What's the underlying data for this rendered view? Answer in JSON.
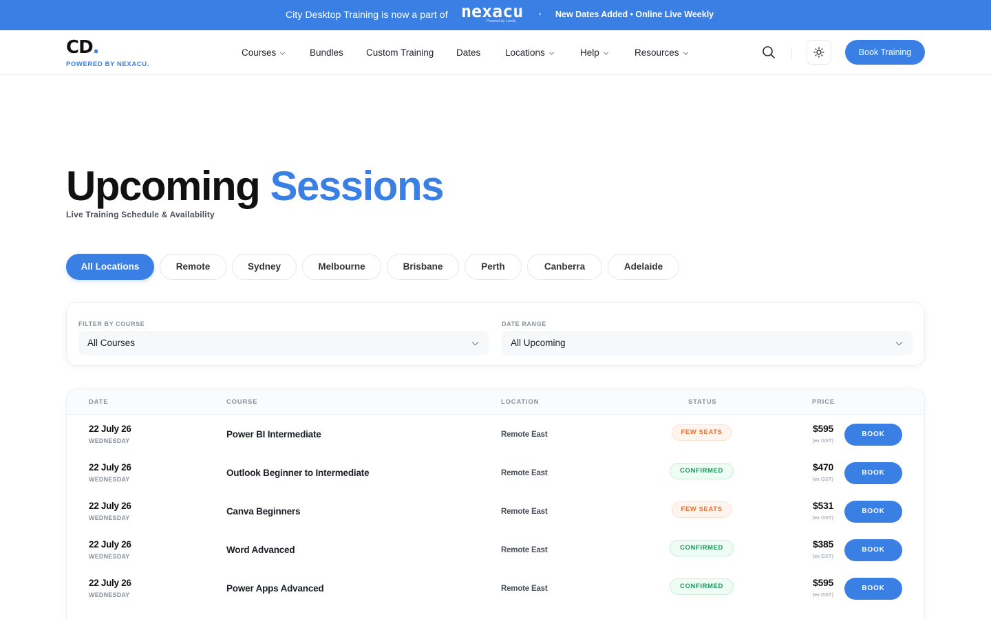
{
  "banner": {
    "text": "City Desktop Training is now a part of",
    "partner_logo": "nexacu",
    "partner_tagline": "Powered by Lumify",
    "news": "New Dates Added • Online Live Weekly"
  },
  "header": {
    "logo_text": "CD",
    "logo_dot": ".",
    "powered_by": "POWERED BY NEXACU.",
    "nav": [
      {
        "label": "Courses",
        "dropdown": true
      },
      {
        "label": "Bundles",
        "dropdown": false
      },
      {
        "label": "Custom Training",
        "dropdown": false
      },
      {
        "label": "Dates",
        "dropdown": false
      },
      {
        "label": "Locations",
        "dropdown": true
      },
      {
        "label": "Help",
        "dropdown": true
      },
      {
        "label": "Resources",
        "dropdown": true
      }
    ],
    "search_icon": "search-icon",
    "theme_icon": "sun-icon",
    "cta_label": "Book Training"
  },
  "hero": {
    "title_main": "Upcoming",
    "title_accent": "Sessions",
    "subtitle": "Live Training Schedule & Availability"
  },
  "locations": {
    "active": "All Locations",
    "items": [
      "All Locations",
      "Remote",
      "Sydney",
      "Melbourne",
      "Brisbane",
      "Perth",
      "Canberra",
      "Adelaide"
    ]
  },
  "filters": {
    "course_label": "FILTER BY COURSE",
    "course_value": "All Courses",
    "date_label": "DATE RANGE",
    "date_value": "All Upcoming"
  },
  "table": {
    "headers": {
      "date": "DATE",
      "course": "COURSE",
      "location": "LOCATION",
      "status": "STATUS",
      "price": "PRICE"
    },
    "book_label": "BOOK",
    "gst_note": "(ex GST)",
    "rows": [
      {
        "date": "22 July 26",
        "day": "WEDNESDAY",
        "course": "Power BI Intermediate",
        "location": "Remote East",
        "status": "FEW SEATS",
        "status_type": "few",
        "price": "$595"
      },
      {
        "date": "22 July 26",
        "day": "WEDNESDAY",
        "course": "Outlook Beginner to Intermediate",
        "location": "Remote East",
        "status": "CONFIRMED",
        "status_type": "conf",
        "price": "$470"
      },
      {
        "date": "22 July 26",
        "day": "WEDNESDAY",
        "course": "Canva Beginners",
        "location": "Remote East",
        "status": "FEW SEATS",
        "status_type": "few",
        "price": "$531"
      },
      {
        "date": "22 July 26",
        "day": "WEDNESDAY",
        "course": "Word Advanced",
        "location": "Remote East",
        "status": "CONFIRMED",
        "status_type": "conf",
        "price": "$385"
      },
      {
        "date": "22 July 26",
        "day": "WEDNESDAY",
        "course": "Power Apps Advanced",
        "location": "Remote East",
        "status": "CONFIRMED",
        "status_type": "conf",
        "price": "$595"
      }
    ]
  },
  "colors": {
    "accent": "#3a7fe3",
    "few_seats": "#e8702a",
    "confirmed": "#1a9a5c"
  }
}
